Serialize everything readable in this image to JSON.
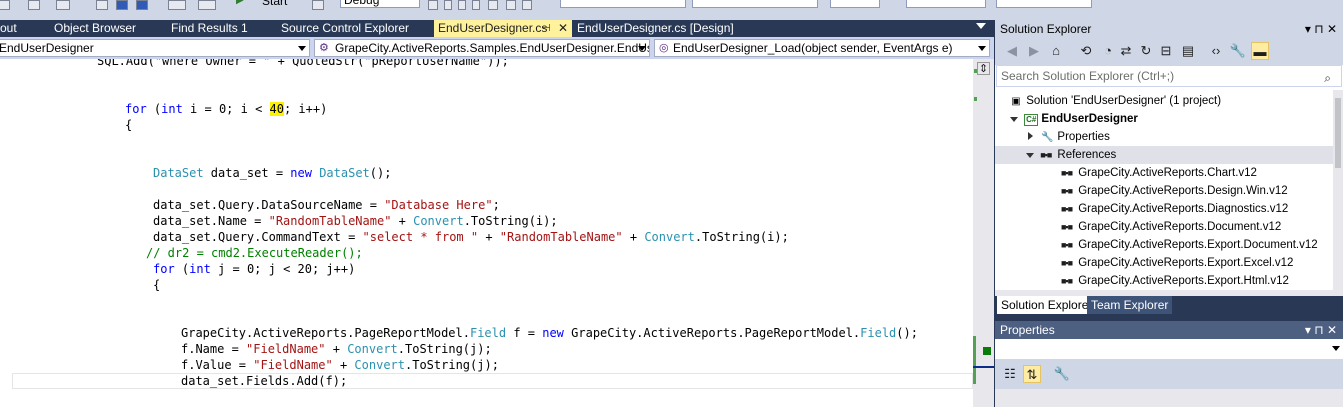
{
  "toolbar": {
    "config_value": "Debug",
    "start_label": "Start"
  },
  "doc_tabs": [
    {
      "label": "out"
    },
    {
      "label": "Object Browser"
    },
    {
      "label": "Find Results 1"
    },
    {
      "label": "Source Control Explorer"
    },
    {
      "label": "EndUserDesigner.cs",
      "active": true
    },
    {
      "label": "EndUserDesigner.cs [Design]"
    }
  ],
  "nav": {
    "project": "EndUserDesigner",
    "type": "GrapeCity.ActiveReports.Samples.EndUserDesigner.EndUserD",
    "member": "EndUserDesigner_Load(object sender, EventArgs e)"
  },
  "code": {
    "line_partial": "SQL.Add(\"where Owner = \" + QuotedStr(\"pReportUserName\"));",
    "for_kw": "for",
    "int_kw": "int",
    "for_i_a": " i = 0; i < ",
    "for_i_num": "40",
    "for_i_b": "; i++)",
    "brace_open": "{",
    "dataset_type": "DataSet",
    "dataset_mid": " data_set = ",
    "new_kw": "new",
    "dataset_end": "();",
    "l_query_src_a": "data_set.Query.DataSourceName = ",
    "l_query_src_str": "\"Database Here\"",
    "l_query_src_b": ";",
    "l_name_a": "data_set.Name = ",
    "l_name_str": "\"RandomTableName\"",
    "l_name_b": " + ",
    "convert": "Convert",
    "tostring_i": ".ToString(i);",
    "l_cmd_a": "data_set.Query.CommandText = ",
    "l_cmd_str1": "\"select * from \"",
    "l_cmd_plus": " + ",
    "l_cmd_str2": "\"RandomTableName\"",
    "comment": "// dr2 = cmd2.ExecuteReader();",
    "for_j_a": " j = 0; j < 20; j++)",
    "field_ns": "GrapeCity.ActiveReports.PageReportModel.",
    "field_type": "Field",
    "field_var": " f = ",
    "field_end": "();",
    "fname_a": "f.Name = ",
    "fname_str": "\"FieldName\"",
    "tostring_j": ".ToString(j);",
    "fvalue_a": "f.Value = ",
    "fields_add": "data_set.Fields.Add(f);"
  },
  "solution_explorer": {
    "title": "Solution Explorer",
    "title_btns": "▾ ⊓ ✕",
    "search_placeholder": "Search Solution Explorer (Ctrl+;)",
    "solution": "Solution 'EndUserDesigner' (1 project)",
    "project": "EndUserDesigner",
    "properties": "Properties",
    "references": "References",
    "refs": [
      "GrapeCity.ActiveReports.Chart.v12",
      "GrapeCity.ActiveReports.Design.Win.v12",
      "GrapeCity.ActiveReports.Diagnostics.v12",
      "GrapeCity.ActiveReports.Document.v12",
      "GrapeCity.ActiveReports.Export.Document.v12",
      "GrapeCity.ActiveReports.Export.Excel.v12",
      "GrapeCity.ActiveReports.Export.Html.v12"
    ]
  },
  "bottom_tabs": [
    {
      "label": "Solution Explorer",
      "active": true
    },
    {
      "label": "Team Explorer"
    }
  ],
  "properties_panel": {
    "title": "Properties",
    "title_btns": "▾ ⊓ ✕"
  },
  "colors": {
    "active_tab": "#fff29d",
    "chrome_dark": "#293955",
    "keyword": "#0000ff",
    "type": "#2b91af",
    "string": "#a31515",
    "comment": "#008000"
  }
}
